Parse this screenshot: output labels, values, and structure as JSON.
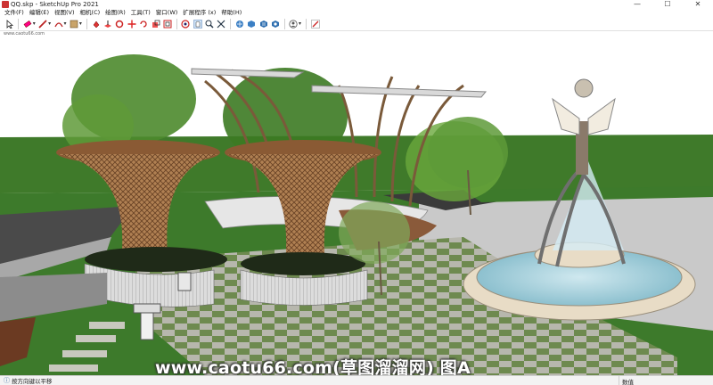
{
  "window": {
    "title": "QQ.skp - SketchUp Pro 2021",
    "minimize_glyph": "—",
    "maximize_glyph": "☐",
    "close_glyph": "✕"
  },
  "menu": [
    "文件(F)",
    "编辑(E)",
    "视图(V)",
    "相机(C)",
    "绘图(R)",
    "工具(T)",
    "窗口(W)",
    "扩展程序 (x)",
    "帮助(H)"
  ],
  "toolbar": {
    "icons": [
      "select-icon",
      "eraser-icon",
      "pencil-icon",
      "arc-icon",
      "shape-icon",
      "paint-icon",
      "pushpull-icon",
      "followme-icon",
      "move-icon",
      "rotate-icon",
      "scale-icon",
      "offset-icon",
      "orbit-icon",
      "pan-icon",
      "zoom-icon",
      "zoom-extents-icon",
      "warehouse-icon",
      "extension-warehouse-icon",
      "layout-icon",
      "style-builder-icon",
      "account-icon",
      "edit-icon"
    ]
  },
  "address_watermark": "www.caotu66.com",
  "viewport": {
    "watermark": "www.caotu66.com(草图溜溜网) 图A"
  },
  "status": {
    "hint": "按方向键以平移",
    "measurements_label": "数值"
  }
}
